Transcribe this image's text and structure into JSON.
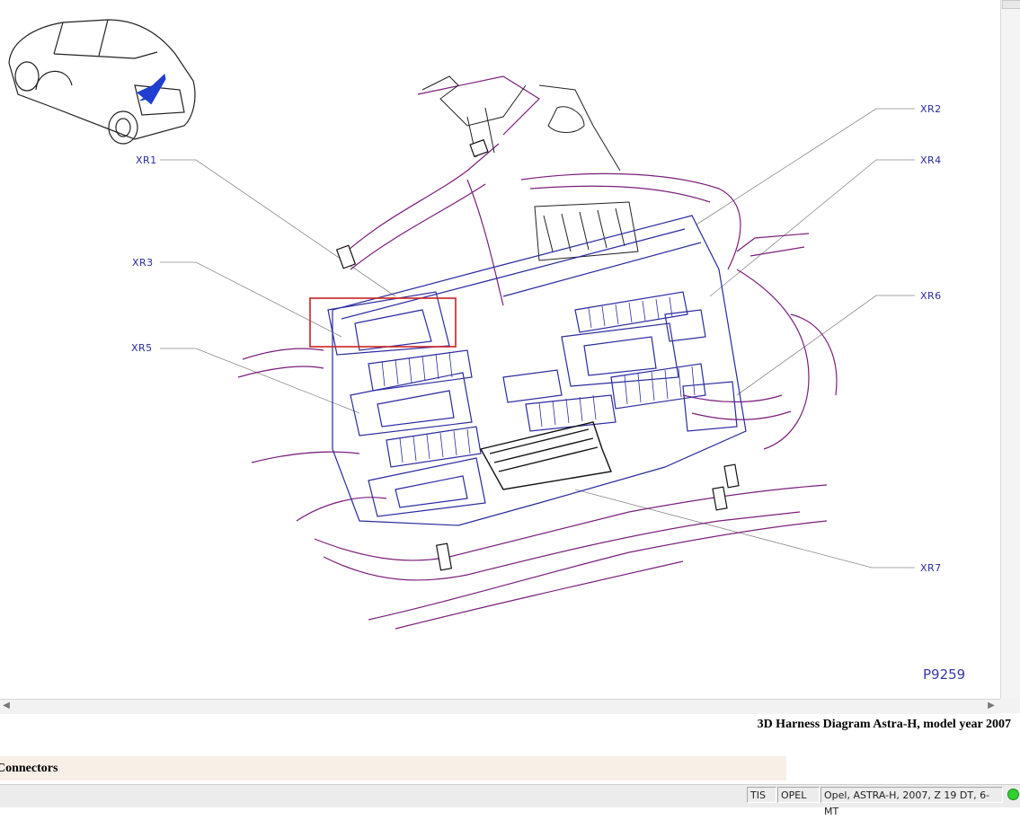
{
  "diagram": {
    "callouts": [
      "XR1",
      "XR2",
      "XR3",
      "XR4",
      "XR5",
      "XR6",
      "XR7"
    ],
    "picture_number": "P9259",
    "colors": {
      "harness": "#7a1f7a",
      "fuse_box": "#2a2aa0",
      "highlight": "#cc2222",
      "arrow": "#1f3fd0"
    }
  },
  "caption": "3D Harness Diagram Astra-H, model year 2007",
  "section_header": "Connectors",
  "status": {
    "app": "TIS",
    "make": "OPEL",
    "vehicle": "Opel, ASTRA-H, 2007, Z 19 DT, 6-MT",
    "indicator_color": "#2fd12f"
  },
  "icons": [
    "car-locator-icon",
    "arrow-left-icon",
    "arrow-right-icon",
    "status-led-icon"
  ]
}
